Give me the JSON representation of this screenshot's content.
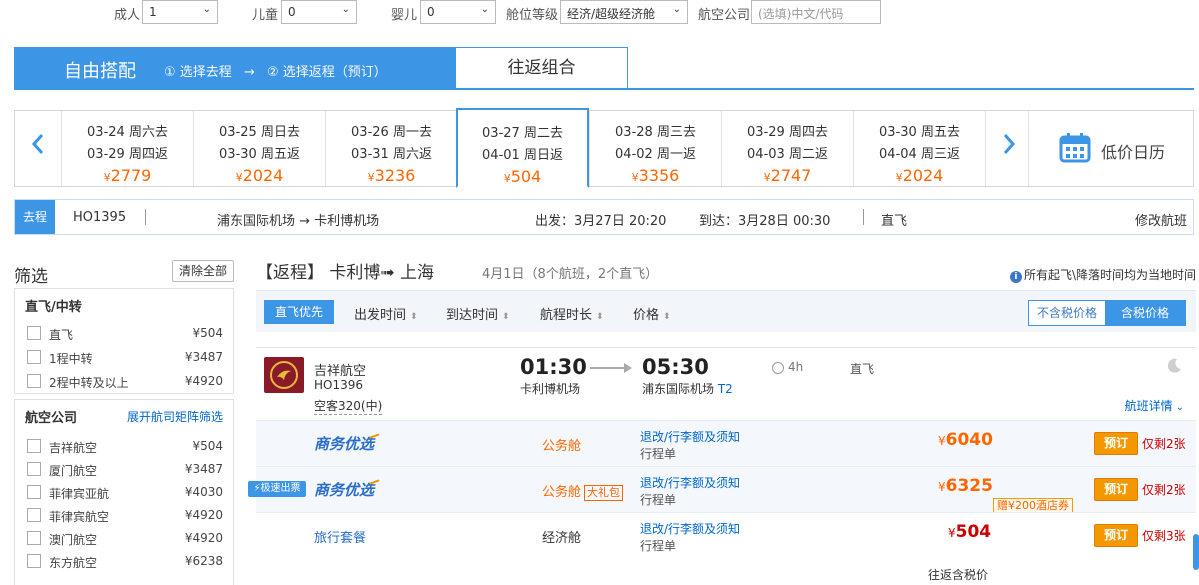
{
  "search": {
    "adult_label": "成人",
    "adult_value": "1",
    "child_label": "儿童",
    "child_value": "0",
    "infant_label": "婴儿",
    "infant_value": "0",
    "cabin_label": "舱位等级",
    "cabin_value": "经济/超级经济舱",
    "airline_label": "航空公司",
    "airline_placeholder": "(选填)中文/代码"
  },
  "mode": {
    "free_label": "自由搭配",
    "step1": "① 选择去程",
    "arrow": "→",
    "step2": "② 选择返程（预订）",
    "combo_label": "往返组合"
  },
  "dates": [
    {
      "out": "03-24 周六去",
      "ret": "03-29 周四返",
      "currency": "¥",
      "price": "2779"
    },
    {
      "out": "03-25 周日去",
      "ret": "03-30 周五返",
      "currency": "¥",
      "price": "2024"
    },
    {
      "out": "03-26 周一去",
      "ret": "03-31 周六返",
      "currency": "¥",
      "price": "3236"
    },
    {
      "out": "03-27 周二去",
      "ret": "04-01 周日返",
      "currency": "¥",
      "price": "504"
    },
    {
      "out": "03-28 周三去",
      "ret": "04-02 周一返",
      "currency": "¥",
      "price": "3356"
    },
    {
      "out": "03-29 周四去",
      "ret": "04-03 周二返",
      "currency": "¥",
      "price": "2747"
    },
    {
      "out": "03-30 周五去",
      "ret": "04-04 周三返",
      "currency": "¥",
      "price": "2024"
    }
  ],
  "calendar_label": "低价日历",
  "outbound": {
    "tag": "去程",
    "flight_no": "HO1395",
    "route": "浦东国际机场 → 卡利博机场",
    "depart": "出发：3月27日 20:20",
    "arrive": "到达：3月28日 00:30",
    "stops": "直飞",
    "modify": "修改航班"
  },
  "filter": {
    "title": "筛选",
    "clear": "清除全部",
    "stops_header": "直飞/中转",
    "stops": [
      {
        "name": "直飞",
        "price": "¥504"
      },
      {
        "name": "1程中转",
        "price": "¥3487"
      },
      {
        "name": "2程中转及以上",
        "price": "¥4920"
      }
    ],
    "airline_header": "航空公司",
    "airline_link": "展开航司矩阵筛选",
    "airlines": [
      {
        "name": "吉祥航空",
        "price": "¥504"
      },
      {
        "name": "厦门航空",
        "price": "¥3487"
      },
      {
        "name": "菲律宾亚航",
        "price": "¥4030"
      },
      {
        "name": "菲律宾航空",
        "price": "¥4920"
      },
      {
        "name": "澳门航空",
        "price": "¥4920"
      },
      {
        "name": "东方航空",
        "price": "¥6238"
      }
    ]
  },
  "return_head": {
    "title": "【返程】 卡利博➟ 上海",
    "sub": "4月1日（8个航班，2个直飞）",
    "note": "所有起飞\\降落时间均为当地时间"
  },
  "sort": {
    "direct_first": "直飞优先",
    "depart_time": "出发时间",
    "arrive_time": "到达时间",
    "duration": "航程时长",
    "price": "价格",
    "no_tax": "不含税价格",
    "with_tax": "含税价格"
  },
  "flight": {
    "airline": "吉祥航空",
    "flight_no": "HO1396",
    "aircraft": "空客320(中)",
    "dep_time": "01:30",
    "dep_airport": "卡利博机场",
    "arr_time": "05:30",
    "arr_airport": "浦东国际机场",
    "arr_terminal": "T2",
    "duration": "4h",
    "stops": "直飞",
    "detail": "航班详情"
  },
  "fares": [
    {
      "brand": "商务优选",
      "cabin": "公务舱",
      "gift": "",
      "rule": "退改/行李额及须知",
      "doc": "行程单",
      "currency": "¥",
      "price": "6040",
      "coupon": "",
      "book": "预订",
      "left": "仅剩2张",
      "fast": ""
    },
    {
      "brand": "商务优选",
      "cabin": "公务舱",
      "gift": "大礼包",
      "rule": "退改/行李额及须知",
      "doc": "行程单",
      "currency": "¥",
      "price": "6325",
      "coupon": "赠¥200酒店券",
      "book": "预订",
      "left": "仅剩2张",
      "fast": "极速出票"
    },
    {
      "brand": "旅行套餐",
      "cabin": "经济舱",
      "gift": "",
      "rule": "退改/行李额及须知",
      "doc": "行程单",
      "currency": "¥",
      "price": "504",
      "coupon": "",
      "book": "预订",
      "left": "仅剩3张",
      "fast": ""
    }
  ],
  "roundtrip_tax": "往返含税价",
  "colors": {
    "primary": "#3d95e6",
    "price": "#ff6600",
    "book": "#f39800",
    "alert": "#cc0000"
  }
}
